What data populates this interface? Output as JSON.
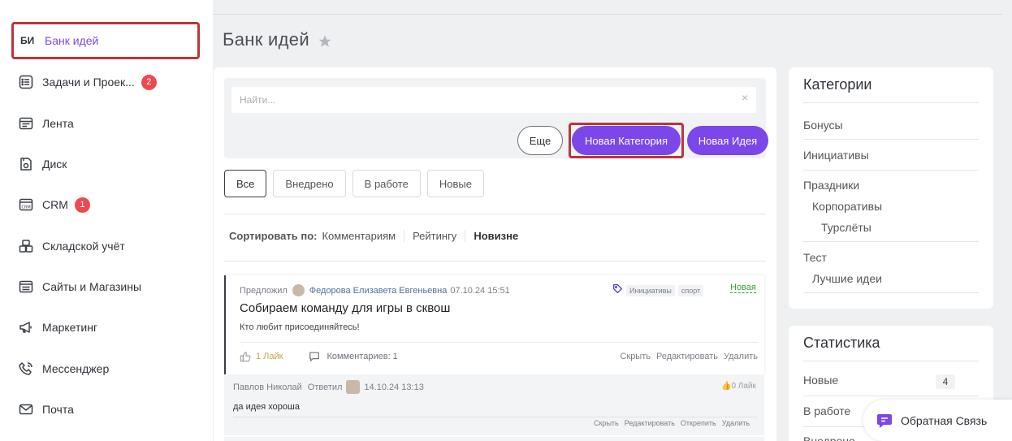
{
  "sidebar": {
    "active": {
      "abbr": "БИ",
      "label": "Банк идей"
    },
    "items": [
      {
        "label": "Задачи и Проек...",
        "icon": "list-icon",
        "badge": "2"
      },
      {
        "label": "Лента",
        "icon": "feed-icon"
      },
      {
        "label": "Диск",
        "icon": "disk-icon"
      },
      {
        "label": "CRM",
        "icon": "crm-icon",
        "badge": "1"
      },
      {
        "label": "Складской учёт",
        "icon": "warehouse-icon"
      },
      {
        "label": "Сайты и Магазины",
        "icon": "sites-icon"
      },
      {
        "label": "Маркетинг",
        "icon": "megaphone-icon"
      },
      {
        "label": "Мессенджер",
        "icon": "phone-icon"
      },
      {
        "label": "Почта",
        "icon": "mail-icon"
      }
    ]
  },
  "page": {
    "title": "Банк идей"
  },
  "search": {
    "placeholder": "Найти...",
    "clear": "×"
  },
  "buttons": {
    "more": "Еще",
    "new_category": "Новая Категория",
    "new_idea": "Новая Идея"
  },
  "filters": [
    "Все",
    "Внедрено",
    "В работе",
    "Новые"
  ],
  "sort": {
    "label": "Сортировать по:",
    "options": [
      "Комментариям",
      "Рейтингу",
      "Новизне"
    ]
  },
  "idea": {
    "proposed": "Предложил",
    "author": "Федорова Елизавета Евгеньевна",
    "date": "07.10.24 15:51",
    "tags": [
      "Инициативы",
      "спорт"
    ],
    "status": "Новая",
    "title": "Собираем команду для игры в сквош",
    "text": "Кто любит присоединяйтесь!",
    "likes": "1 Лайк",
    "comments": "Комментариев: 1",
    "actions": [
      "Скрыть",
      "Редактировать",
      "Удалить"
    ]
  },
  "comment": {
    "author": "Павлов Николай",
    "replied": "Ответил",
    "date": "14.10.24 13:13",
    "likes": "0 Лайк",
    "text": "да идея хороша",
    "actions": [
      "Скрыть",
      "Редактировать",
      "Открепить",
      "Удалить"
    ]
  },
  "categories": {
    "title": "Категории",
    "items": [
      "Бонусы",
      "Инициативы",
      "Праздники",
      "Корпоративы",
      "Турслёты",
      "Тест",
      "Лучшие идеи"
    ]
  },
  "stats": {
    "title": "Статистика",
    "rows": [
      {
        "label": "Новые",
        "value": "4"
      },
      {
        "label": "В работе"
      },
      {
        "label": "Внедрено"
      }
    ]
  },
  "feedback": {
    "label": "Обратная Связь"
  },
  "colors": {
    "accent": "#7b47e8",
    "highlight": "#b8363a",
    "badge": "#f0484f",
    "status_new": "#3d9a3d"
  }
}
